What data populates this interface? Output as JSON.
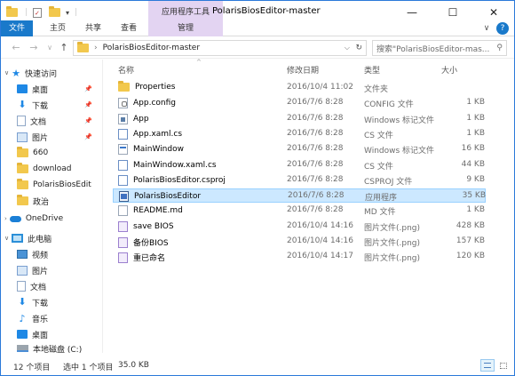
{
  "window": {
    "title": "PolarisBiosEditor-master",
    "contextual_group": "应用程序工具",
    "controls": {
      "minimize": "—",
      "maximize": "☐",
      "close": "✕"
    }
  },
  "ribbon": {
    "tabs": [
      {
        "label": "文件",
        "style": "file"
      },
      {
        "label": "主页",
        "style": "normal"
      },
      {
        "label": "共享",
        "style": "normal"
      },
      {
        "label": "查看",
        "style": "normal"
      },
      {
        "label": "管理",
        "style": "context"
      }
    ],
    "expand_glyph": "∨",
    "help_glyph": "?"
  },
  "address": {
    "path": "PolarisBiosEditor-master",
    "refresh_glyph": "↻",
    "dropdown_glyph": "⌵",
    "search_placeholder": "搜索\"PolarisBiosEditor-mas...",
    "search_glyph": "⚲"
  },
  "nav_pane": {
    "quick_access": "快速访问",
    "quick_items": [
      {
        "label": "桌面",
        "icon": "desktop-icon",
        "pinned": true
      },
      {
        "label": "下载",
        "icon": "download-icon",
        "pinned": true
      },
      {
        "label": "文档",
        "icon": "document-icon",
        "pinned": true
      },
      {
        "label": "图片",
        "icon": "picture-icon",
        "pinned": true
      },
      {
        "label": "660",
        "icon": "folder-icon",
        "pinned": false
      },
      {
        "label": "download",
        "icon": "folder-icon",
        "pinned": false
      },
      {
        "label": "PolarisBiosEdit",
        "icon": "folder-icon",
        "pinned": false
      },
      {
        "label": "政治",
        "icon": "folder-icon",
        "pinned": false
      }
    ],
    "onedrive": "OneDrive",
    "this_pc": "此电脑",
    "pc_items": [
      {
        "label": "视频",
        "icon": "video-icon"
      },
      {
        "label": "图片",
        "icon": "picture-icon"
      },
      {
        "label": "文档",
        "icon": "document-icon"
      },
      {
        "label": "下载",
        "icon": "download-icon"
      },
      {
        "label": "音乐",
        "icon": "music-icon"
      },
      {
        "label": "桌面",
        "icon": "desktop-icon"
      },
      {
        "label": "本地磁盘 (C:)",
        "icon": "drive-icon"
      }
    ]
  },
  "columns": {
    "name": "名称",
    "date": "修改日期",
    "type": "类型",
    "size": "大小",
    "sort_glyph": "^"
  },
  "files": [
    {
      "name": "Properties",
      "date": "2016/10/4 11:02",
      "type": "文件夹",
      "size": "",
      "icon": "folder"
    },
    {
      "name": "App.config",
      "date": "2016/7/6 8:28",
      "type": "CONFIG 文件",
      "size": "1 KB",
      "icon": "cfg"
    },
    {
      "name": "App",
      "date": "2016/7/6 8:28",
      "type": "Windows 标记文件",
      "size": "1 KB",
      "icon": "app"
    },
    {
      "name": "App.xaml.cs",
      "date": "2016/7/6 8:28",
      "type": "CS 文件",
      "size": "1 KB",
      "icon": "cs"
    },
    {
      "name": "MainWindow",
      "date": "2016/7/6 8:28",
      "type": "Windows 标记文件",
      "size": "16 KB",
      "icon": "win"
    },
    {
      "name": "MainWindow.xaml.cs",
      "date": "2016/7/6 8:28",
      "type": "CS 文件",
      "size": "44 KB",
      "icon": "cs"
    },
    {
      "name": "PolarisBiosEditor.csproj",
      "date": "2016/7/6 8:28",
      "type": "CSPROJ 文件",
      "size": "9 KB",
      "icon": "cs"
    },
    {
      "name": "PolarisBiosEditor",
      "date": "2016/7/6 8:28",
      "type": "应用程序",
      "size": "35 KB",
      "icon": "exe",
      "selected": true
    },
    {
      "name": "README.md",
      "date": "2016/7/6 8:28",
      "type": "MD 文件",
      "size": "1 KB",
      "icon": "txt"
    },
    {
      "name": "save BIOS",
      "date": "2016/10/4 14:16",
      "type": "图片文件(.png)",
      "size": "428 KB",
      "icon": "png"
    },
    {
      "name": "备份BIOS",
      "date": "2016/10/4 14:16",
      "type": "图片文件(.png)",
      "size": "157 KB",
      "icon": "png"
    },
    {
      "name": "重已命名",
      "date": "2016/10/4 14:17",
      "type": "图片文件(.png)",
      "size": "120 KB",
      "icon": "png"
    }
  ],
  "status": {
    "count": "12 个项目",
    "selection": "选中 1 个项目",
    "size": "35.0 KB"
  },
  "colors": {
    "accent": "#1979ca",
    "selection_bg": "#cce8ff",
    "context_tab": "#e3d4f2",
    "folder": "#f2c84d"
  }
}
